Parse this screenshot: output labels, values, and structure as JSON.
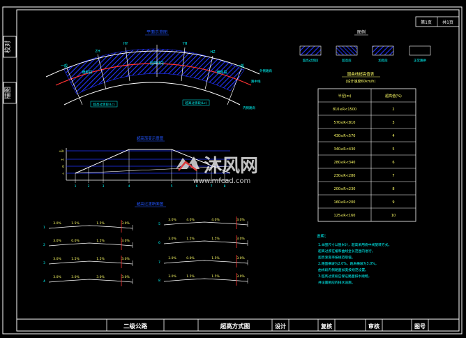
{
  "side_labels": {
    "top": "校对",
    "bottom": "描图"
  },
  "page_corner": {
    "sheet": "第1页",
    "total": "共1页"
  },
  "plan": {
    "title": "平面示意图",
    "top_labels": [
      "ZH",
      "HY",
      "YH",
      "HZ"
    ],
    "left_markers": [
      "一般",
      "一般"
    ],
    "right_markers": [
      "一般",
      "一般"
    ],
    "zone_labels": [
      "缓和段",
      "圆曲线段",
      "缓和段"
    ],
    "segment_labels": [
      "超高过渡段(Lc)",
      "超高过渡段(Lc)"
    ],
    "center_label": "路中线",
    "outer_label": "外侧路肩",
    "inner_label": "内侧路肩"
  },
  "profile": {
    "title": "超高渐变示意图",
    "y_labels": [
      "+ih",
      "+i",
      "0",
      "-i"
    ],
    "x_labels": [
      "1",
      "2",
      "3",
      "4",
      "5",
      "6",
      "7",
      "8"
    ]
  },
  "sections": {
    "title": "超高过渡断面图",
    "rows_left": [
      {
        "id": "1",
        "vals": [
          "3.0%",
          "1.5%",
          "1.5%",
          "3.0%"
        ]
      },
      {
        "id": "2",
        "vals": [
          "3.0%",
          "0.0%",
          "1.5%",
          "3.0%"
        ]
      },
      {
        "id": "3",
        "vals": [
          "3.0%",
          "1.5%",
          "1.5%",
          "3.0%"
        ]
      },
      {
        "id": "4",
        "vals": [
          "3.0%",
          "3.0%",
          "3.0%",
          "3.0%"
        ]
      }
    ],
    "rows_right": [
      {
        "id": "5",
        "vals": [
          "3.0%",
          "4.0%",
          "4.0%",
          "3.0%"
        ]
      },
      {
        "id": "6",
        "vals": [
          "3.0%",
          "1.5%",
          "1.5%",
          "3.0%"
        ]
      },
      {
        "id": "7",
        "vals": [
          "3.0%",
          "0.0%",
          "1.5%",
          "3.0%"
        ]
      },
      {
        "id": "8",
        "vals": [
          "3.0%",
          "1.5%",
          "1.5%",
          "3.0%"
        ]
      }
    ]
  },
  "legend": {
    "title": "图例",
    "items": [
      "超高过渡段",
      "超高段",
      "加宽段",
      "正常路拱"
    ]
  },
  "table": {
    "title": "圆曲线超高值表",
    "subtitle": "(设计速度60km/h)",
    "headers": [
      "半径(m)",
      "超高值(%)"
    ],
    "rows": [
      [
        "810≤R<1500",
        "2"
      ],
      [
        "570≤R<810",
        "3"
      ],
      [
        "430≤R<570",
        "4"
      ],
      [
        "340≤R<430",
        "5"
      ],
      [
        "280≤R<340",
        "6"
      ],
      [
        "230≤R<280",
        "7"
      ],
      [
        "200≤R<230",
        "8"
      ],
      [
        "160≤R<200",
        "9"
      ],
      [
        "125≤R<160",
        "10"
      ]
    ]
  },
  "notes": {
    "title": "说明：",
    "lines": [
      "1.本图尺寸以厘米计，超高采用绕中线旋转方式，",
      "  超高过渡在缓和曲线全长范围内进行，",
      "  超高渐变率按规范取值。",
      "2.路面横坡为2.0%，路肩横坡为3.0%，",
      "  曲线段内侧路面加宽按规范设置。",
      "3.超高过渡段应保证路面排水顺畅，",
      "  并设置相应的排水设施。"
    ]
  },
  "watermark": {
    "brand": "沐风网",
    "url": "www.mfcad.com"
  },
  "title_block": {
    "project": "二级公路",
    "drawing": "超高方式图",
    "design": "设计",
    "check": "复核",
    "review": "审核",
    "sheet_no": "图号"
  },
  "colors": {
    "border": "#ffffff",
    "hatch": "#2233ff",
    "highlight": "#ff3333",
    "annotation": "#00ffff",
    "text": "#ffff66"
  }
}
